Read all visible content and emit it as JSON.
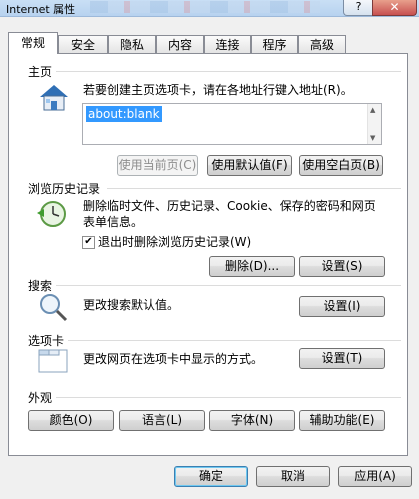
{
  "window": {
    "title": "Internet 属性",
    "help_label": "?",
    "close_label": "✕"
  },
  "tabs": [
    {
      "label": "常规"
    },
    {
      "label": "安全"
    },
    {
      "label": "隐私"
    },
    {
      "label": "内容"
    },
    {
      "label": "连接"
    },
    {
      "label": "程序"
    },
    {
      "label": "高级"
    }
  ],
  "homepage": {
    "heading": "主页",
    "description": "若要创建主页选项卡，请在各地址行键入地址(R)。",
    "url_value": "about:blank",
    "buttons": {
      "use_current": "使用当前页(C)",
      "use_default": "使用默认值(F)",
      "use_blank": "使用空白页(B)"
    }
  },
  "history": {
    "heading": "浏览历史记录",
    "description_line1": "删除临时文件、历史记录、Cookie、保存的密码和网页",
    "description_line2": "表单信息。",
    "checkbox_label": "退出时删除浏览历史记录(W)",
    "checkbox_checked": true,
    "buttons": {
      "delete": "删除(D)...",
      "settings": "设置(S)"
    }
  },
  "search": {
    "heading": "搜索",
    "description": "更改搜索默认值。",
    "settings": "设置(I)"
  },
  "tabsection": {
    "heading": "选项卡",
    "description": "更改网页在选项卡中显示的方式。",
    "settings": "设置(T)"
  },
  "appearance": {
    "heading": "外观",
    "buttons": {
      "colors": "颜色(O)",
      "languages": "语言(L)",
      "fonts": "字体(N)",
      "accessibility": "辅助功能(E)"
    }
  },
  "footer": {
    "ok": "确定",
    "cancel": "取消",
    "apply": "应用(A)"
  },
  "colors": {
    "selection": "#3399ff",
    "panel_bg": "#ffffff",
    "dialog_bg": "#f0f0f0"
  }
}
